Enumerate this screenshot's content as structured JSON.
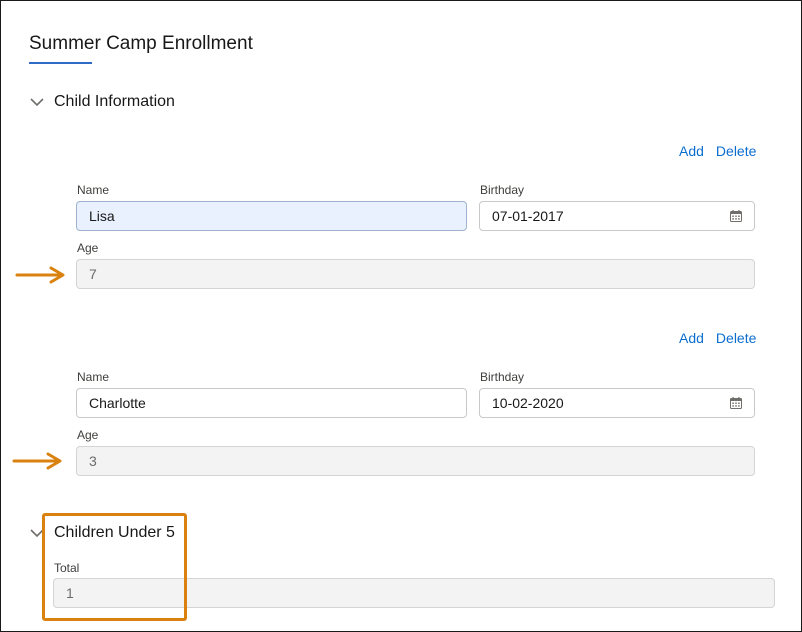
{
  "page": {
    "title": "Summer Camp Enrollment"
  },
  "sections": {
    "child_information": {
      "title": "Child Information"
    },
    "children_under_5": {
      "title": "Children Under 5",
      "total_label": "Total",
      "total_value": "1"
    }
  },
  "children": [
    {
      "add_label": "Add",
      "delete_label": "Delete",
      "name_label": "Name",
      "name_value": "Lisa",
      "birthday_label": "Birthday",
      "birthday_value": "07-01-2017",
      "age_label": "Age",
      "age_value": "7"
    },
    {
      "add_label": "Add",
      "delete_label": "Delete",
      "name_label": "Name",
      "name_value": "Charlotte",
      "birthday_label": "Birthday",
      "birthday_value": "10-02-2020",
      "age_label": "Age",
      "age_value": "3"
    }
  ],
  "colors": {
    "accent": "#0b6ecf",
    "annotation": "#d9820f",
    "title_underline": "#2e6bc6"
  },
  "icons": [
    "chevron-down-icon",
    "calendar-icon",
    "arrow-right-icon"
  ]
}
